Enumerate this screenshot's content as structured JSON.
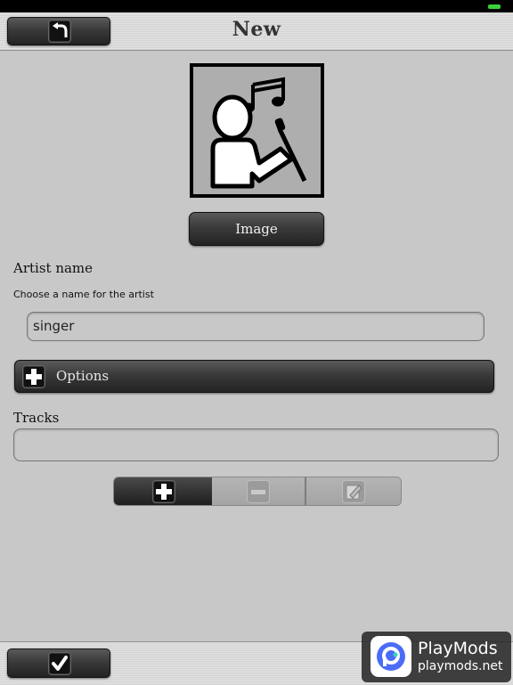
{
  "navbar": {
    "title": "New"
  },
  "artist": {
    "image_button_label": "Image",
    "name_label": "Artist name",
    "name_hint": "Choose a name for the artist",
    "name_value": "singer"
  },
  "options": {
    "label": "Options"
  },
  "tracks": {
    "label": "Tracks"
  },
  "watermark": {
    "title": "PlayMods",
    "subtitle": "playmods.net"
  },
  "colors": {
    "battery": "#39d23a",
    "dark_button": "#2e2e2e",
    "background": "#c8c8c8"
  }
}
